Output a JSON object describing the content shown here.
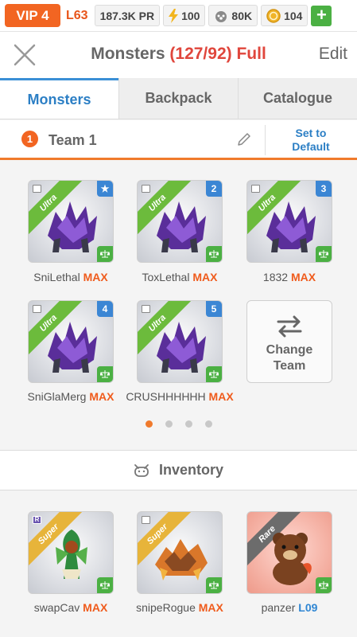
{
  "status": {
    "vip": "VIP 4",
    "level": "L63",
    "power": "187.3K PR",
    "energy": "100",
    "food": "80K",
    "coins": "104",
    "plus": "+"
  },
  "header": {
    "title": "Monsters",
    "count": "(127/92) Full",
    "edit": "Edit"
  },
  "tabs": [
    "Monsters",
    "Backpack",
    "Catalogue"
  ],
  "team": {
    "number": "1",
    "name": "Team 1",
    "default_line1": "Set to",
    "default_line2": "Default"
  },
  "team_monsters": [
    {
      "name": "SniLethal",
      "level": "MAX",
      "rarity": "Ultra",
      "slot": "★"
    },
    {
      "name": "ToxLethal",
      "level": "MAX",
      "rarity": "Ultra",
      "slot": "2"
    },
    {
      "name": "1832",
      "level": "MAX",
      "rarity": "Ultra",
      "slot": "3"
    },
    {
      "name": "SniGlaMerg",
      "level": "MAX",
      "rarity": "Ultra",
      "slot": "4"
    },
    {
      "name": "CRUSHHHHHH",
      "level": "MAX",
      "rarity": "Ultra",
      "slot": "5"
    }
  ],
  "change_team": {
    "line1": "Change",
    "line2": "Team"
  },
  "pager": {
    "pages": 4,
    "current": 1
  },
  "inventory": {
    "title": "Inventory",
    "items": [
      {
        "name": "swapCav",
        "level": "MAX",
        "rarity": "Super"
      },
      {
        "name": "snipeRogue",
        "level": "MAX",
        "rarity": "Super"
      },
      {
        "name": "panzer",
        "level": "L09",
        "rarity": "Rare"
      }
    ]
  },
  "colors": {
    "accent": "#f26522",
    "blue": "#2c7fc5",
    "ultra": "#6cbb3c",
    "super": "#e7b43a",
    "rare": "#6c6c6c"
  }
}
